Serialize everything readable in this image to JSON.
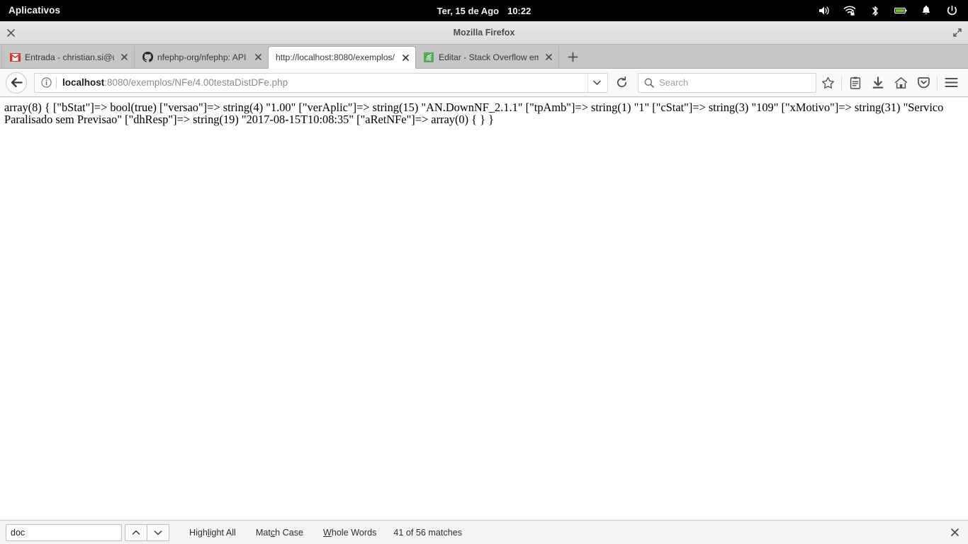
{
  "system_panel": {
    "apps_menu_label": "Aplicativos",
    "clock_date": "Ter, 15 de Ago",
    "clock_time": "10:22",
    "tray_icons": [
      "volume-icon",
      "wifi-locked-icon",
      "bluetooth-icon",
      "battery-icon",
      "notification-bell-icon",
      "power-icon"
    ],
    "battery_color": "#6fc32a",
    "background_color": "#000000"
  },
  "window": {
    "title": "Mozilla Firefox",
    "close_label": "✖",
    "maximize_label": "⤡"
  },
  "tabs": [
    {
      "label": "Entrada - christian.si@unoc",
      "favicon": "gmail-icon",
      "active": false,
      "close_label": "✖"
    },
    {
      "label": "nfephp-org/nfephp: API par",
      "favicon": "github-icon",
      "active": false,
      "close_label": "✖"
    },
    {
      "label": "http://localhost:8080/exemplos/",
      "favicon": "none",
      "active": true,
      "close_label": "✖"
    },
    {
      "label": "Editar - Stack Overflow em F",
      "favicon": "stackoverflow-icon",
      "active": false,
      "close_label": "✖"
    }
  ],
  "new_tab_label": "+",
  "toolbar": {
    "back_label": "←",
    "reload_label": "↻",
    "url_host": "localhost",
    "url_path": ":8080/exemplos/NFe/4.00testaDistDFe.php",
    "url_full": "localhost:8080/exemplos/NFe/4.00testaDistDFe.php",
    "identity_icon": "info-circle-icon",
    "dropdown_icon": "chevron-down-icon",
    "search_placeholder": "Search",
    "search_value": "",
    "icons": [
      "bookmark-star-icon",
      "library-icon",
      "downloads-icon",
      "home-icon",
      "pocket-icon",
      "menu-hamburger-icon"
    ]
  },
  "page": {
    "var_dump": "array(8) { [\"bStat\"]=> bool(true) [\"versao\"]=> string(4) \"1.00\" [\"verAplic\"]=> string(15) \"AN.DownNF_2.1.1\" [\"tpAmb\"]=> string(1) \"1\" [\"cStat\"]=> string(3) \"109\" [\"xMotivo\"]=> string(31) \"Servico Paralisado sem Previsao\" [\"dhResp\"]=> string(19) \"2017-08-15T10:08:35\" [\"aRetNFe\"]=> array(0) { } }"
  },
  "findbar": {
    "input_value": "doc",
    "input_placeholder": "",
    "prev_label": "⌃",
    "next_label": "⌄",
    "highlight_all_label": "Highlight All",
    "highlight_all_accesskey": "l",
    "match_case_label": "Match Case",
    "match_case_accesskey": "c",
    "whole_words_label": "Whole Words",
    "whole_words_accesskey": "W",
    "status": "41 of 56 matches",
    "close_label": "✖"
  }
}
